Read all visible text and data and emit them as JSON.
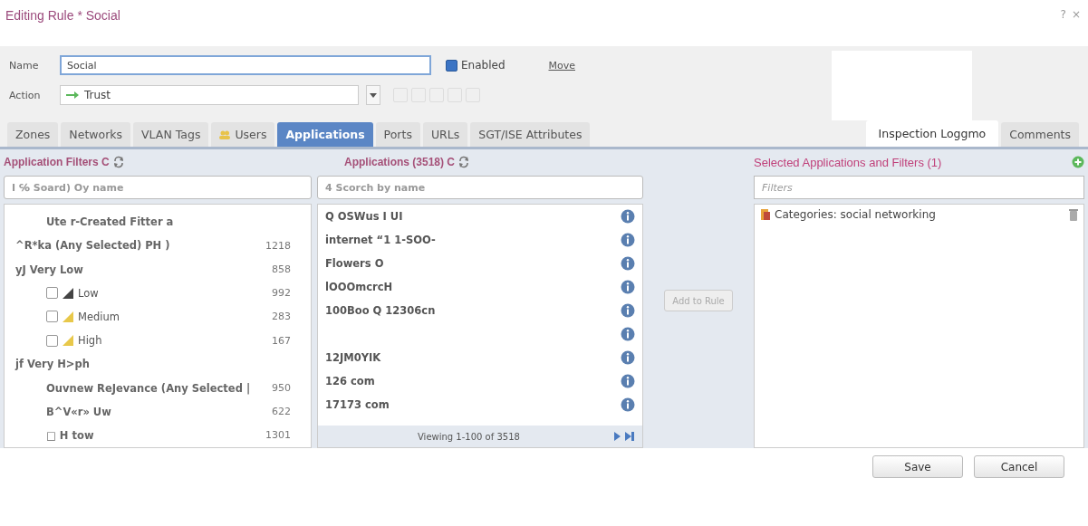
{
  "window": {
    "title": "Editing Rule * Social",
    "help": "?",
    "close": "×"
  },
  "form": {
    "name_label": "Name",
    "name_value": "Social",
    "enabled": {
      "label": "Enabled",
      "checked": true
    },
    "move_link": "Move",
    "action_label": "Action",
    "action_value": "Trust"
  },
  "tabs": [
    {
      "label": "Zones",
      "selected": false
    },
    {
      "label": "Networks",
      "selected": false
    },
    {
      "label": "VLAN Tags",
      "selected": false
    },
    {
      "label": "Users",
      "selected": false,
      "kind": "icon"
    },
    {
      "label": "Applications",
      "selected": true
    },
    {
      "label": "Ports",
      "selected": false
    },
    {
      "label": "URLs",
      "selected": false
    },
    {
      "label": "SGT/ISE Attributes",
      "selected": false
    },
    {
      "label": "Inspection Loggmo",
      "selected": false,
      "kind": "patch"
    },
    {
      "label": "Comments",
      "selected": false
    }
  ],
  "filters_panel": {
    "title": "Application Filters C",
    "search_placeholder": "I ℅ Soard) Oy name",
    "rows": [
      {
        "kind": "group",
        "label": "Ute r-Created Fitter a"
      },
      {
        "kind": "group",
        "label": "^R*ka (Any Selected) PH )",
        "count": "1218"
      },
      {
        "kind": "group",
        "label": "yJ Very Low",
        "count": "858"
      },
      {
        "kind": "option",
        "label": "Low",
        "count": "992",
        "checked": false
      },
      {
        "kind": "option",
        "label": "Medium",
        "count": "283",
        "checked": false
      },
      {
        "kind": "option",
        "label": "High",
        "count": "167",
        "checked": false
      },
      {
        "kind": "group",
        "label": "jf Very H>ph"
      },
      {
        "kind": "group",
        "label": "Ouvnew ReJevance (Any Selected |",
        "count": "950"
      },
      {
        "kind": "group",
        "label": "B^V«r» Uw",
        "count": "622"
      },
      {
        "kind": "group",
        "label": "□ H tow",
        "count": "1301"
      }
    ]
  },
  "apps_panel": {
    "title": "Applications (3518) C",
    "search_placeholder": "4 Scorch by name",
    "rows": [
      "Q OSWus I UI",
      "internet “1 1-SOO-",
      "Flowers O",
      "lOOOmcrcH",
      "100Boo Q 12306cn",
      "",
      "12JM0YIK",
      "126 com",
      "17173 com"
    ],
    "footer": "Viewing 1-100 of 3518"
  },
  "add_button": {
    "label": "Add to Rule",
    "disabled": true
  },
  "selected_panel": {
    "title": "Selected Applications and Filters (1)",
    "filter_placeholder": "Filters",
    "items": [
      "Categories: social networking"
    ]
  },
  "buttons": [
    "Save",
    "Cancel"
  ]
}
